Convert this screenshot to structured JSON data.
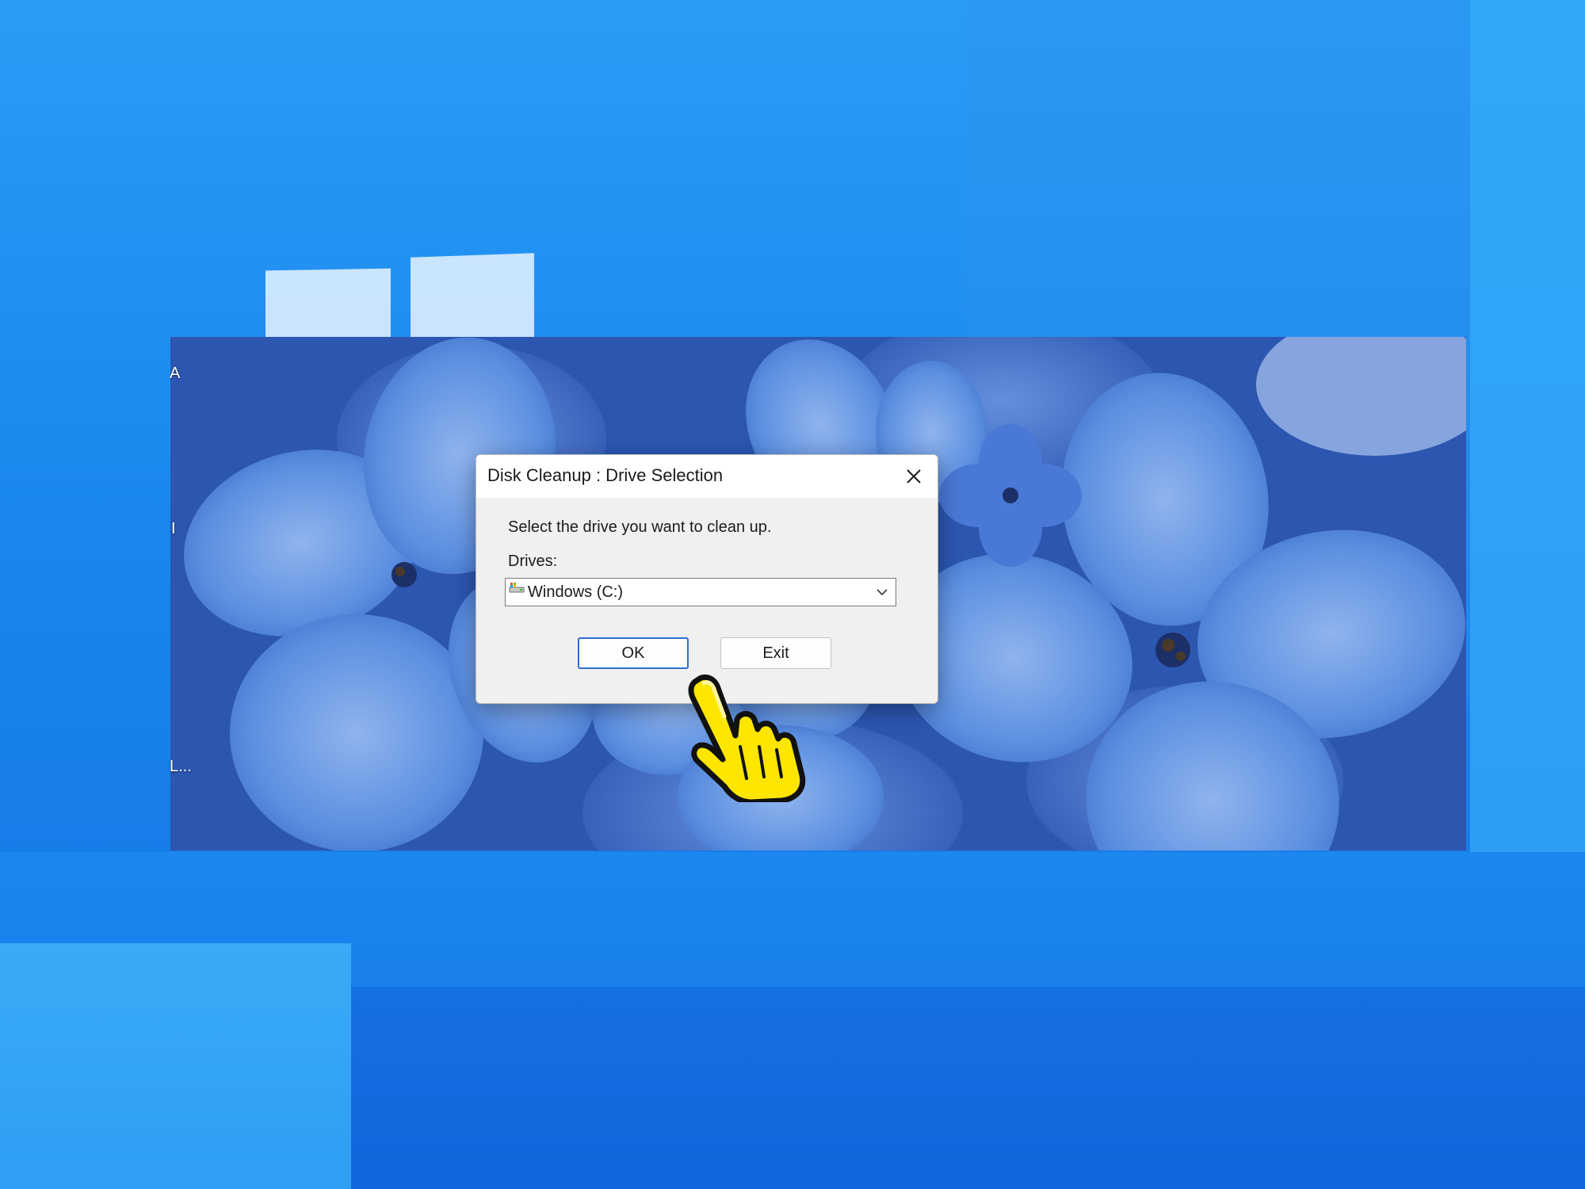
{
  "dialog": {
    "title": "Disk Cleanup : Drive Selection",
    "prompt": "Select the drive you want to clean up.",
    "drives_label": "Drives:",
    "selected_drive": "Windows (C:)",
    "ok_label": "OK",
    "exit_label": "Exit"
  },
  "desktop": {
    "edge_labels": [
      "A",
      "I",
      "L..."
    ]
  },
  "icons": {
    "close": "close-icon",
    "drive": "drive-icon",
    "dropdown": "chevron-down-icon",
    "cursor": "hand-pointer-cursor-icon",
    "logo": "windows-logo-icon"
  },
  "colors": {
    "desktop_blue": "#1a86ee",
    "dialog_bg": "#f0f0f0",
    "titlebar_bg": "#ffffff",
    "focus_border": "#2f6fd0",
    "cursor_yellow": "#ffe600"
  }
}
